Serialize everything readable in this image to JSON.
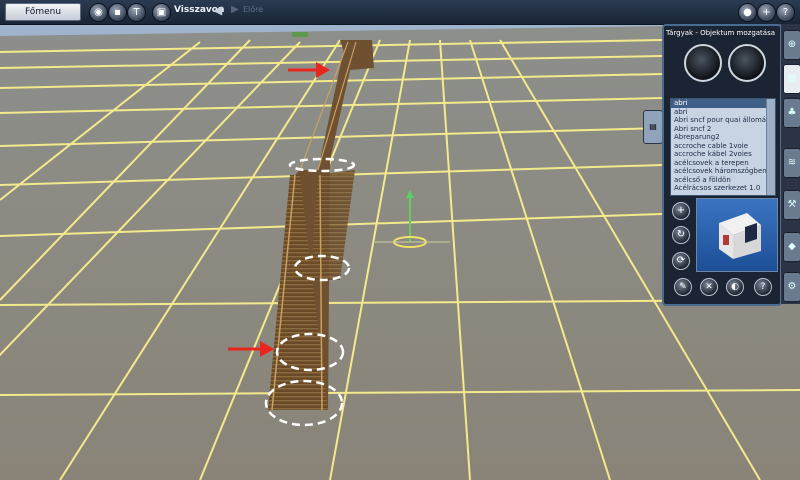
{
  "toolbar": {
    "main_menu": "Főmenu",
    "undo": "Visszavon",
    "redo": "Előre",
    "left_icons": [
      "globe-icon",
      "save-icon",
      "tools-icon",
      "camera-icon"
    ],
    "right_icons": [
      "bulb-icon",
      "plus-icon",
      "help-icon"
    ]
  },
  "panel": {
    "title": "Tárgyak - Objektum mozgatása",
    "tools": [
      "place-object-icon",
      "move-object-icon"
    ],
    "items": [
      "abri",
      "abri",
      "Abri sncf pour quai állomás",
      "Abri sncf 2",
      "Abreparung2",
      "accroche cable 1voie",
      "accroche kábel 2voies",
      "acélcsovek a terepen",
      "acélcsovek háromszögben",
      "acélcső a földön",
      "Acélrácsos szerkezet 1.0"
    ],
    "selected_index": 0,
    "side_buttons": [
      "zoom-in-icon",
      "rotate-icon",
      "refresh-icon"
    ],
    "bottom_buttons": [
      "eyedropper-icon",
      "delete-icon",
      "filter-icon",
      "help-icon"
    ]
  },
  "side_tabs": [
    "zoom-icon",
    "track-icon",
    "tree-icon",
    "spline-icon",
    "wrench-icon",
    "water-icon",
    "settings-icon"
  ],
  "colors": {
    "grid": "#f2e98a",
    "ground": "#8c8c83",
    "sky": "#9fb3cc",
    "track": "#7a5a32",
    "arrow": "#e8261e"
  }
}
